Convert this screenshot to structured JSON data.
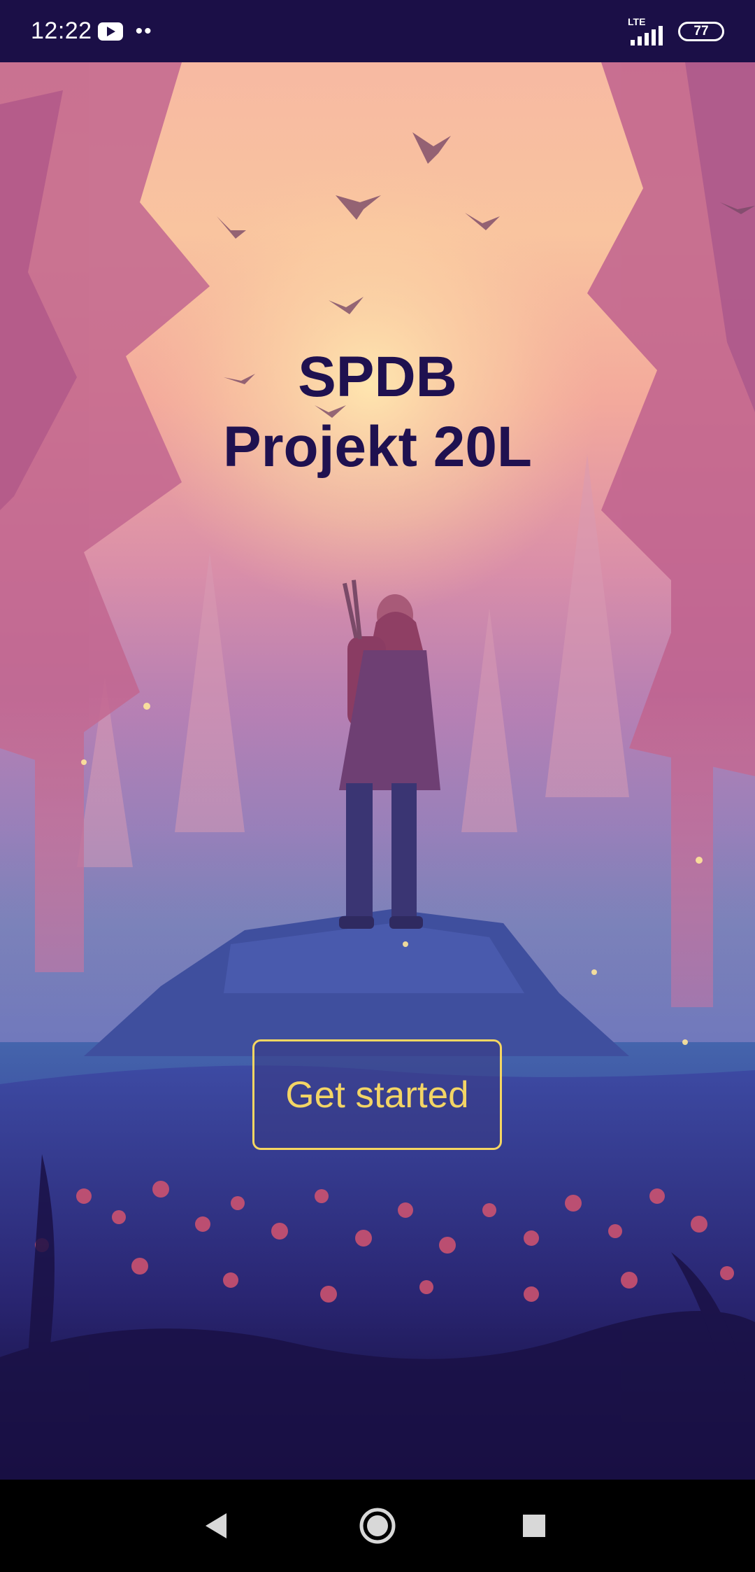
{
  "status_bar": {
    "time": "12:22",
    "notification_dots": "••",
    "network": "LTE",
    "battery": "77"
  },
  "title": {
    "line1": "SPDB",
    "line2": "Projekt 20L"
  },
  "cta": {
    "label": "Get started"
  },
  "colors": {
    "status_bar_bg": "#1b0f47",
    "title": "#1f1150",
    "button_border": "#f5d662",
    "button_text": "#f3d565"
  },
  "icons": {
    "youtube": "youtube-icon",
    "signal": "signal-icon",
    "battery": "battery-icon",
    "back": "back-triangle-icon",
    "home": "home-circle-icon",
    "recents": "recents-square-icon"
  }
}
